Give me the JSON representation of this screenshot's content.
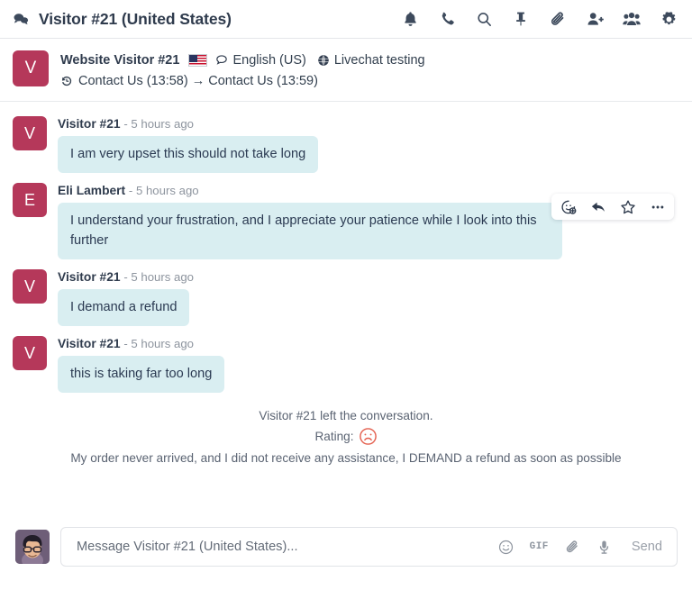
{
  "header": {
    "thread_icon": "chat-bubbles-icon",
    "title": "Visitor #21 (United States)",
    "actions": [
      {
        "name": "notifications-bell-icon",
        "label": "Notifications"
      },
      {
        "name": "phone-call-icon",
        "label": "Call"
      },
      {
        "name": "search-icon",
        "label": "Search"
      },
      {
        "name": "pin-icon",
        "label": "Pinned messages"
      },
      {
        "name": "attachment-paperclip-icon",
        "label": "Attachments"
      },
      {
        "name": "add-user-icon",
        "label": "Add member"
      },
      {
        "name": "members-group-icon",
        "label": "Members"
      },
      {
        "name": "settings-gear-icon",
        "label": "Settings"
      }
    ]
  },
  "visitor": {
    "avatar_initial": "V",
    "avatar_color": "#b5385a",
    "name": "Website Visitor #21",
    "country_flag": "us-flag-icon",
    "language_icon": "speech-bubble-icon",
    "language": "English (US)",
    "site_icon": "globe-icon",
    "site": "Livechat testing",
    "history_icon": "history-clock-icon",
    "history": "Contact Us (13:58) → Contact Us (13:59)"
  },
  "messages": [
    {
      "avatar_initial": "V",
      "author": "Visitor #21",
      "time": "- 5 hours ago",
      "text": "I am very upset this should not take long",
      "has_actions": false
    },
    {
      "avatar_initial": "E",
      "author": "Eli Lambert",
      "time": "- 5 hours ago",
      "text": "I understand your frustration, and I appreciate your patience while I look into this further",
      "has_actions": true
    },
    {
      "avatar_initial": "V",
      "author": "Visitor #21",
      "time": "- 5 hours ago",
      "text": "I demand a refund",
      "has_actions": false
    },
    {
      "avatar_initial": "V",
      "author": "Visitor #21",
      "time": "- 5 hours ago",
      "text": "this is taking far too long",
      "has_actions": false
    }
  ],
  "message_actions": [
    {
      "name": "add-reaction-icon",
      "label": "Add reaction"
    },
    {
      "name": "reply-arrow-icon",
      "label": "Reply"
    },
    {
      "name": "star-icon",
      "label": "Star message"
    },
    {
      "name": "more-options-icon",
      "label": "More actions"
    }
  ],
  "system": {
    "left_notice": "Visitor #21 left the conversation.",
    "rating_label": "Rating:",
    "rating_icon": "sad-face-icon",
    "rating_color": "#e4604f",
    "rating_value": "sad",
    "comment": "My order never arrived, and I did not receive any assistance, I DEMAND a refund as soon as possible"
  },
  "composer": {
    "avatar": "agent-avatar-image",
    "placeholder": "Message Visitor #21 (United States)...",
    "value": "",
    "tools": [
      {
        "name": "emoji-smiley-icon",
        "label": "Emoji"
      },
      {
        "name": "gif-icon",
        "label": "GIF"
      },
      {
        "name": "attachment-paperclip-icon",
        "label": "Attach file"
      },
      {
        "name": "microphone-icon",
        "label": "Record audio"
      }
    ],
    "gif_label": "GIF",
    "send_label": "Send"
  },
  "theme": {
    "bubble_bg": "#d9eef1",
    "avatar_bg": "#b5385a",
    "text": "#2b3a52",
    "muted": "#8d949e"
  }
}
